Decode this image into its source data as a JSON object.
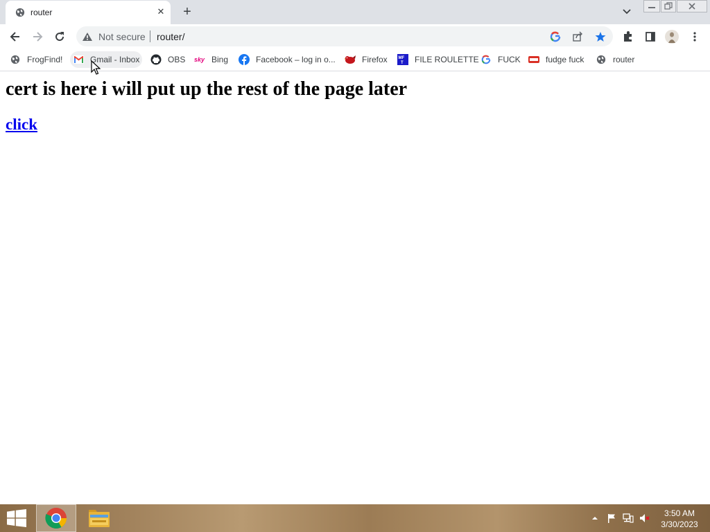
{
  "tab": {
    "title": "router"
  },
  "toolbar": {
    "security_label": "Not secure",
    "url": "router/"
  },
  "bookmarks": [
    {
      "label": "FrogFind!",
      "icon": "globe-icon"
    },
    {
      "label": "Gmail - Inbox",
      "icon": "gmail-icon"
    },
    {
      "label": "OBS",
      "icon": "github-icon"
    },
    {
      "label": "Bing",
      "icon": "sky-icon"
    },
    {
      "label": "Facebook – log in o...",
      "icon": "facebook-icon"
    },
    {
      "label": "Firefox",
      "icon": "bird-icon"
    },
    {
      "label": "FILE ROULETTE",
      "icon": "mft-icon"
    },
    {
      "label": "FUCK",
      "icon": "google-icon"
    },
    {
      "label": "fudge fuck",
      "icon": "bookmark-red-icon"
    },
    {
      "label": "router",
      "icon": "globe-icon"
    }
  ],
  "page": {
    "heading": "cert is here i will put up the rest of the page later",
    "link": "click"
  },
  "taskbar": {
    "time": "3:50 AM",
    "date": "3/30/2023"
  },
  "colors": {
    "tabstrip": "#dee1e6",
    "link": "#0000ee",
    "star": "#1a73e8"
  }
}
